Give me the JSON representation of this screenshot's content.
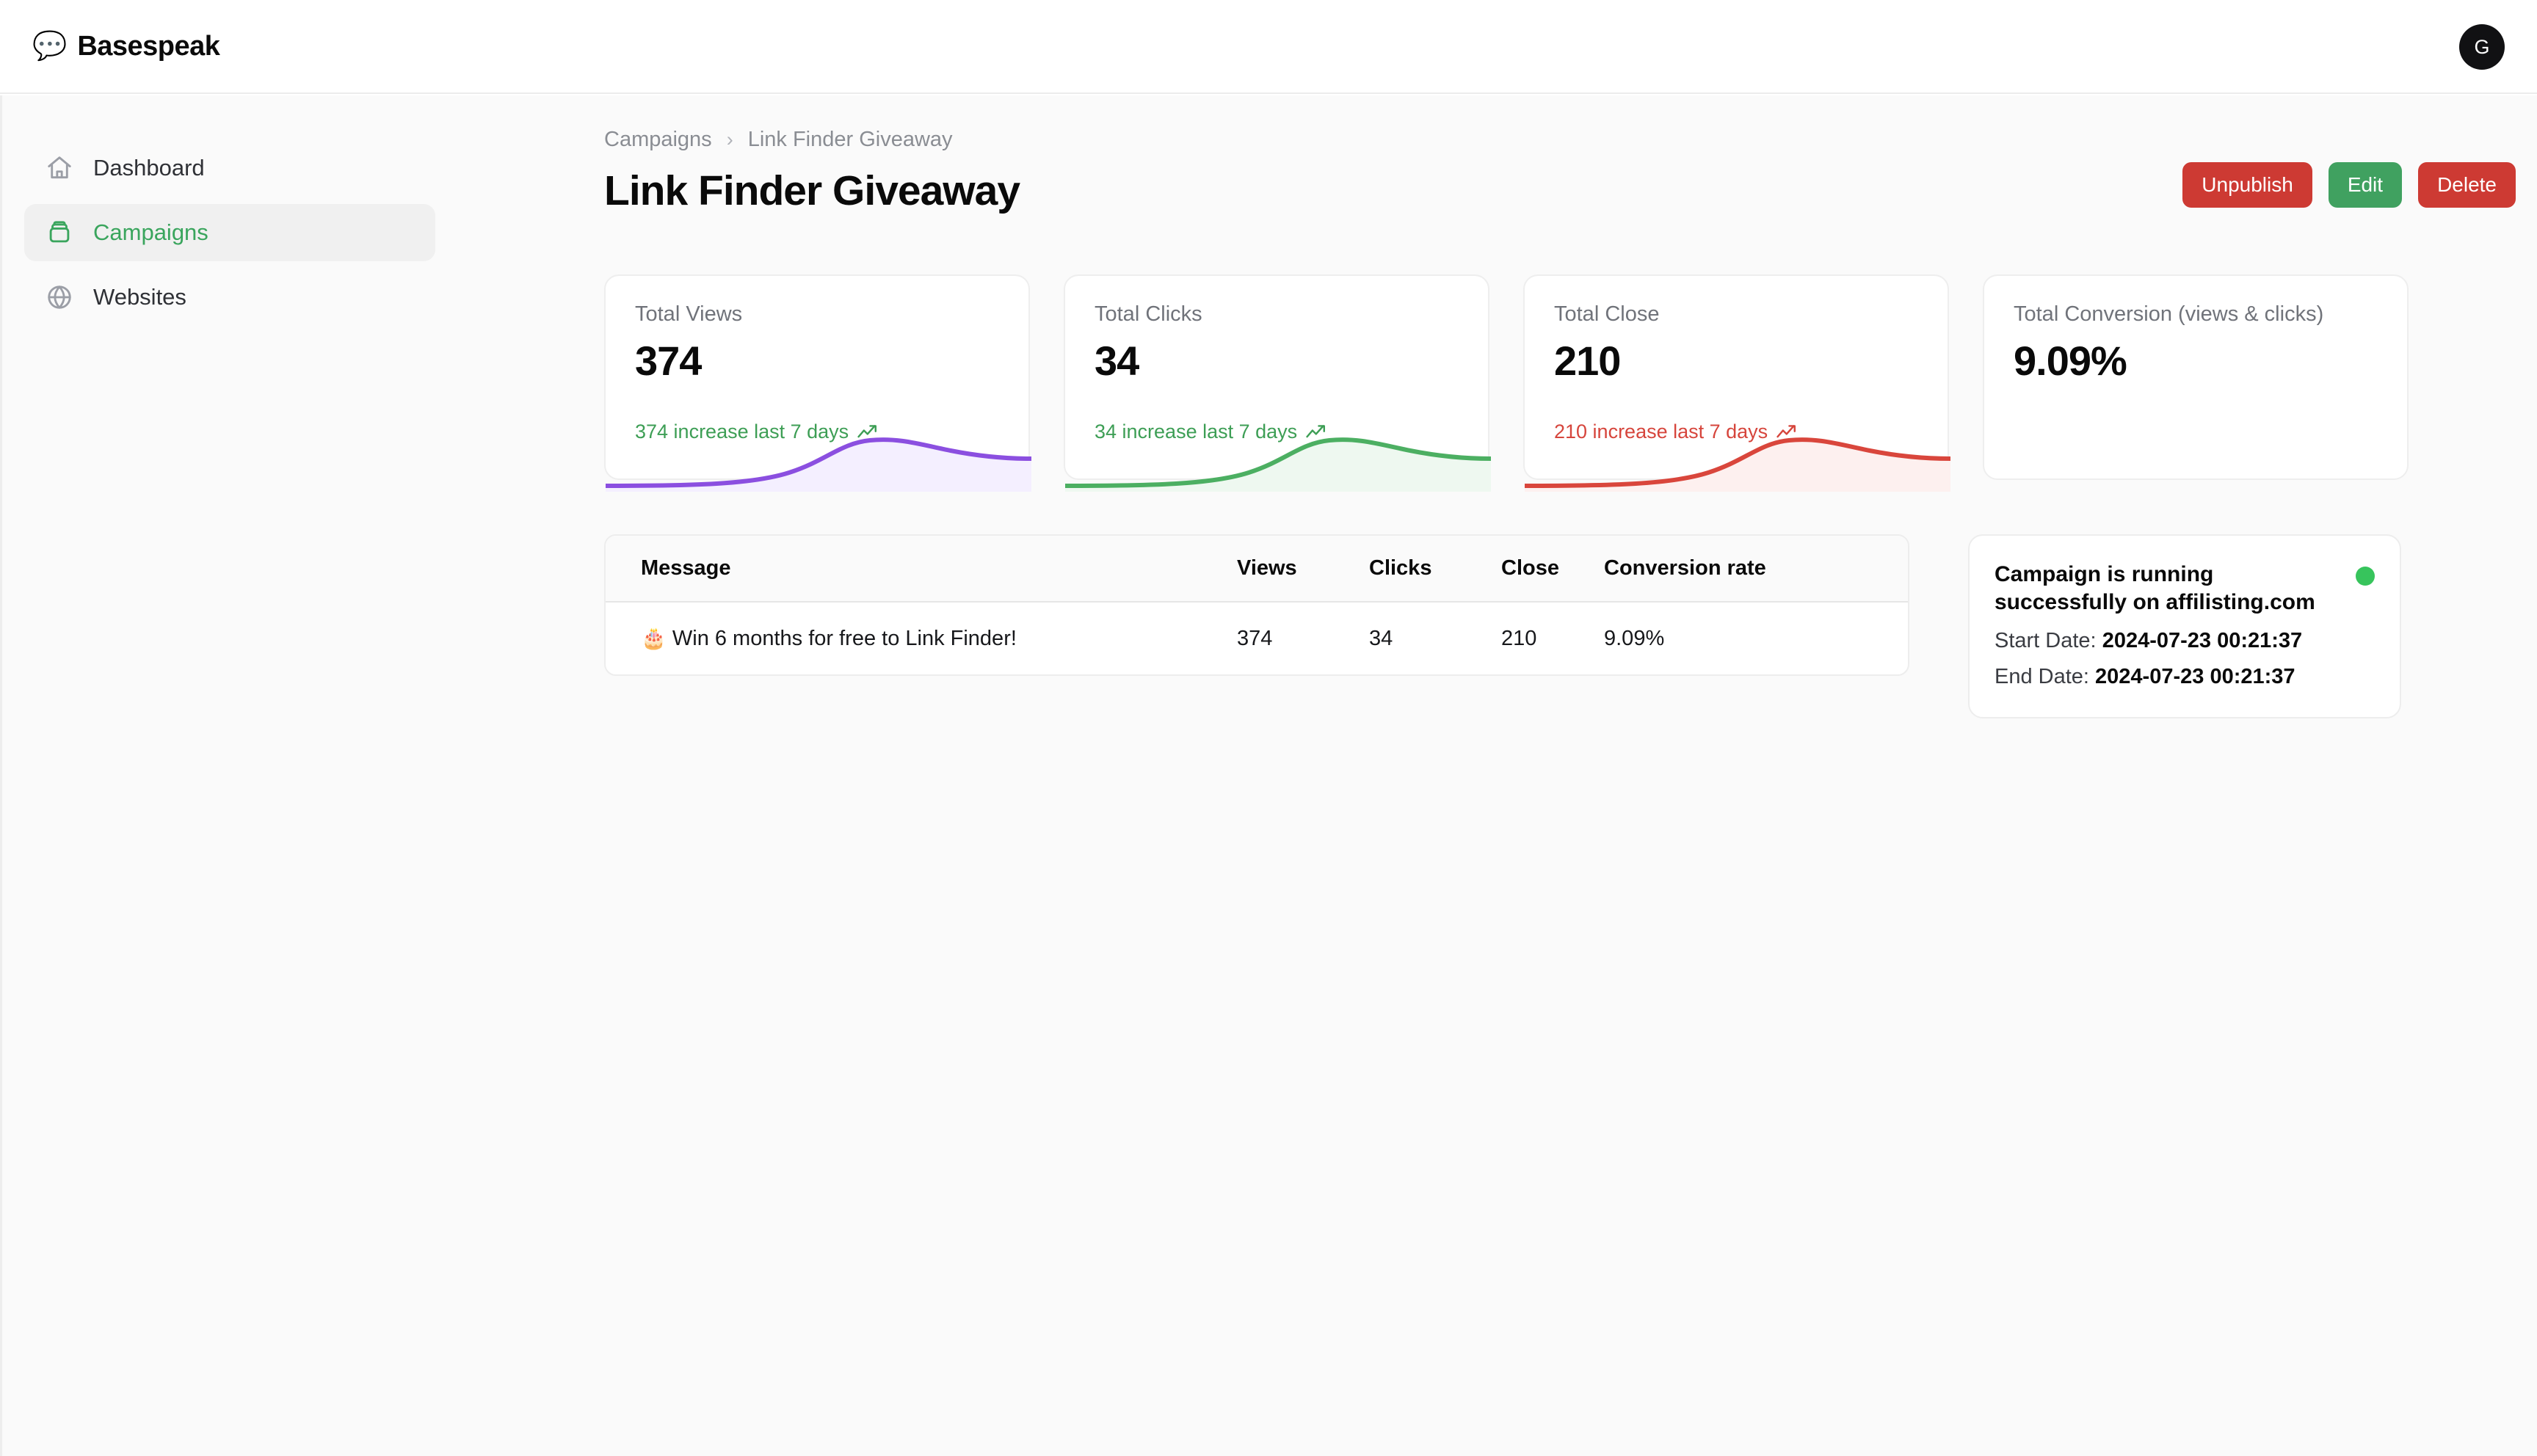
{
  "brand": {
    "emoji": "💬",
    "name": "Basespeak"
  },
  "account": {
    "avatar_initial": "G"
  },
  "sidebar": {
    "items": [
      {
        "label": "Dashboard",
        "icon": "home-icon",
        "active": false
      },
      {
        "label": "Campaigns",
        "icon": "archive-box-icon",
        "active": true
      },
      {
        "label": "Websites",
        "icon": "globe-icon",
        "active": false
      }
    ]
  },
  "breadcrumb": {
    "parent": "Campaigns",
    "separator": "›",
    "current": "Link Finder Giveaway"
  },
  "header": {
    "title": "Link Finder Giveaway",
    "actions": {
      "unpublish": "Unpublish",
      "edit": "Edit",
      "delete": "Delete"
    }
  },
  "colors": {
    "accent_green": "#3aa55d",
    "danger_red": "#cd3a33",
    "success_green": "#40a160",
    "spark_purple": "#8b4fe0",
    "spark_green": "#4caf62",
    "spark_red": "#d9463c",
    "status_dot": "#37c45c"
  },
  "stats": [
    {
      "label": "Total Views",
      "value": "374",
      "sub": "374 increase last 7 days",
      "trend": "up",
      "trend_icon": "trending-up-icon",
      "spark_color": "#8b4fe0",
      "spark_fill": "#f4efff"
    },
    {
      "label": "Total Clicks",
      "value": "34",
      "sub": "34 increase last 7 days",
      "trend": "up",
      "trend_icon": "trending-up-icon",
      "spark_color": "#4caf62",
      "spark_fill": "#eef8f0"
    },
    {
      "label": "Total Close",
      "value": "210",
      "sub": "210 increase last 7 days",
      "trend": "down",
      "trend_icon": "trending-up-icon",
      "spark_color": "#d9463c",
      "spark_fill": "#fdf0ef"
    },
    {
      "label": "Total Conversion (views & clicks)",
      "value": "9.09%",
      "sub": "",
      "trend": "none",
      "trend_icon": "",
      "spark_color": "",
      "spark_fill": ""
    }
  ],
  "table": {
    "columns": [
      "Message",
      "Views",
      "Clicks",
      "Close",
      "Conversion rate"
    ],
    "rows": [
      {
        "emoji": "🎂",
        "message": "Win 6 months for free to Link Finder!",
        "views": "374",
        "clicks": "34",
        "close": "210",
        "conversion": "9.09%"
      }
    ]
  },
  "status": {
    "title": "Campaign is running successfully on affilisting.com",
    "start_label": "Start Date:",
    "start_value": "2024-07-23 00:21:37",
    "end_label": "End Date:",
    "end_value": "2024-07-23 00:21:37"
  },
  "chart_data": [
    {
      "type": "area",
      "title": "Total Views sparkline",
      "x": [
        0,
        1,
        2,
        3,
        4,
        5,
        6
      ],
      "values": [
        0,
        0,
        0,
        0,
        2,
        52,
        46
      ],
      "color": "#8b4fe0",
      "grid": false,
      "legend": "none"
    },
    {
      "type": "area",
      "title": "Total Clicks sparkline",
      "x": [
        0,
        1,
        2,
        3,
        4,
        5,
        6
      ],
      "values": [
        0,
        0,
        0,
        0,
        2,
        52,
        46
      ],
      "color": "#4caf62",
      "grid": false,
      "legend": "none"
    },
    {
      "type": "area",
      "title": "Total Close sparkline",
      "x": [
        0,
        1,
        2,
        3,
        4,
        5,
        6
      ],
      "values": [
        0,
        0,
        0,
        0,
        2,
        52,
        46
      ],
      "color": "#d9463c",
      "grid": false,
      "legend": "none"
    }
  ]
}
